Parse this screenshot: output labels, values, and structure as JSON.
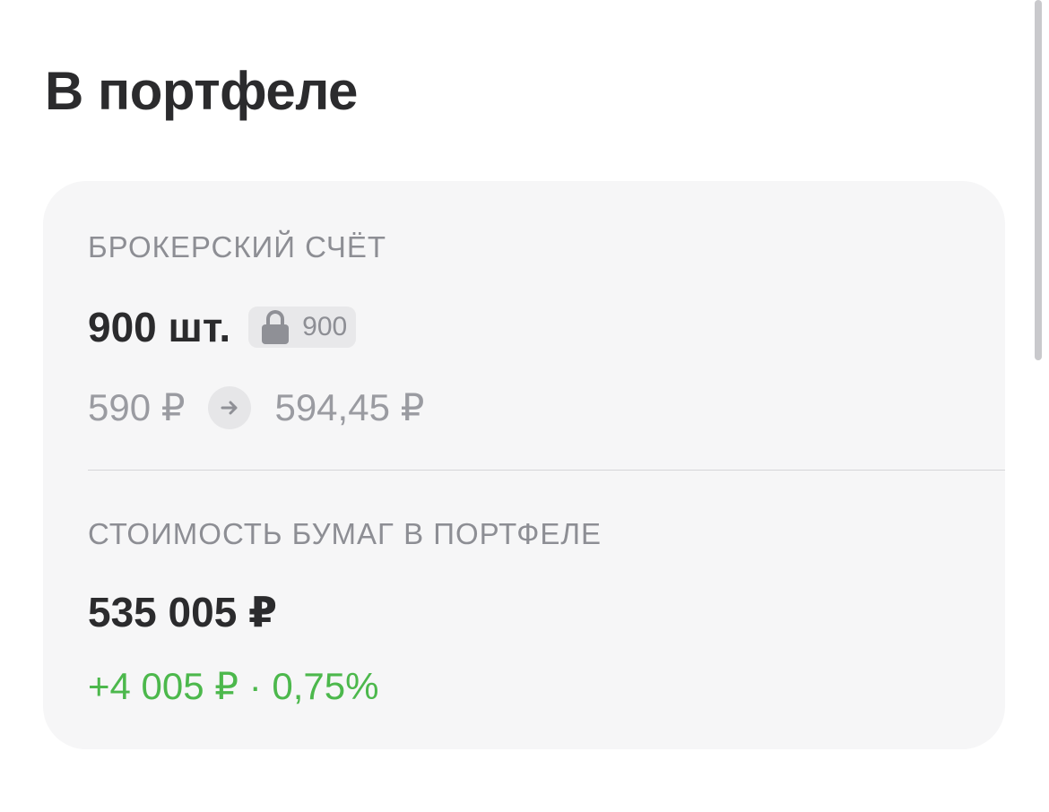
{
  "page": {
    "title": "В портфеле"
  },
  "portfolio": {
    "account_label": "БРОКЕРСКИЙ СЧЁТ",
    "quantity": "900 шт.",
    "blocked": {
      "icon": "lock-icon",
      "count": "900"
    },
    "price_from": "590 ₽",
    "price_arrow_icon": "arrow-right-icon",
    "price_to": "594,45 ₽",
    "value_label": "СТОИМОСТЬ БУМАГ В ПОРТФЕЛЕ",
    "total_value": "535 005 ₽",
    "change": "+4 005 ₽ · 0,75%"
  },
  "colors": {
    "text_primary": "#2b2b2d",
    "text_secondary": "#8d8e94",
    "positive": "#4cb84c",
    "card_background": "#f6f6f7"
  }
}
